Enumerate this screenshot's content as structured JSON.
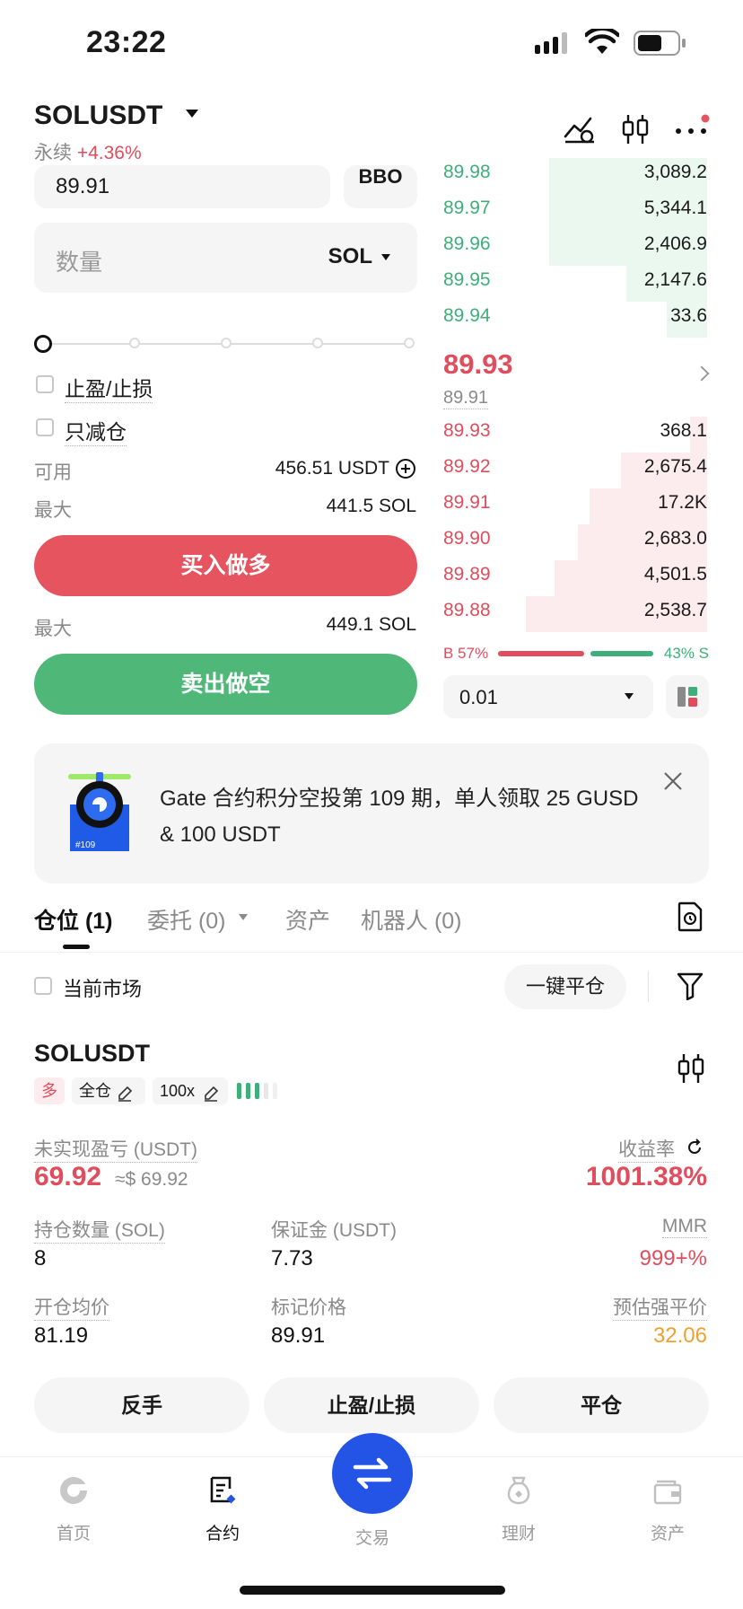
{
  "status_bar": {
    "time": "23:22"
  },
  "header": {
    "pair": "SOLUSDT",
    "contract_type": "永续",
    "change": "+4.36%"
  },
  "order_form": {
    "price_value": "89.91",
    "bbo_label": "BBO",
    "qty_placeholder": "数量",
    "qty_unit": "SOL",
    "tp_sl_label": "止盈/止损",
    "reduce_only_label": "只减仓",
    "available_label": "可用",
    "available_value": "456.51 USDT",
    "max_label": "最大",
    "max_buy_value": "441.5 SOL",
    "buy_label": "买入做多",
    "max_sell_value": "449.1 SOL",
    "sell_label": "卖出做空",
    "slider_percent": 0
  },
  "order_book": {
    "asks": [
      {
        "price": "89.98",
        "qty": "3,089.2",
        "depth": 0.55
      },
      {
        "price": "89.97",
        "qty": "5,344.1",
        "depth": 0.55
      },
      {
        "price": "89.96",
        "qty": "2,406.9",
        "depth": 0.55
      },
      {
        "price": "89.95",
        "qty": "2,147.6",
        "depth": 0.28
      },
      {
        "price": "89.94",
        "qty": "33.6",
        "depth": 0.14
      }
    ],
    "last_price": "89.93",
    "mark_price": "89.91",
    "bids": [
      {
        "price": "89.93",
        "qty": "368.1",
        "depth": 0.06
      },
      {
        "price": "89.92",
        "qty": "2,675.4",
        "depth": 0.3
      },
      {
        "price": "89.91",
        "qty": "17.2K",
        "depth": 0.41
      },
      {
        "price": "89.90",
        "qty": "2,683.0",
        "depth": 0.45
      },
      {
        "price": "89.89",
        "qty": "4,501.5",
        "depth": 0.53
      },
      {
        "price": "89.88",
        "qty": "2,538.7",
        "depth": 0.63
      }
    ],
    "buy_ratio": "B 57%",
    "sell_ratio": "43% S",
    "tick_size": "0.01"
  },
  "banner": {
    "text": "Gate 合约积分空投第 109 期，单人领取 25 GUSD & 100 USDT",
    "badge": "#109"
  },
  "tabs": [
    {
      "label": "仓位 (1)"
    },
    {
      "label": "委托 (0)"
    },
    {
      "label": "资产"
    },
    {
      "label": "机器人 (0)"
    }
  ],
  "filters": {
    "current_market_label": "当前市场",
    "close_all_label": "一键平仓"
  },
  "position": {
    "pair": "SOLUSDT",
    "side_tag": "多",
    "margin_mode": "全仓",
    "leverage": "100x",
    "upnl_label": "未实现盈亏 (USDT)",
    "upnl_value": "69.92",
    "upnl_usd": "≈$ 69.92",
    "roe_label": "收益率",
    "roe_value": "1001.38%",
    "size_label": "持仓数量 (SOL)",
    "size_value": "8",
    "margin_label": "保证金 (USDT)",
    "margin_value": "7.73",
    "mmr_label": "MMR",
    "mmr_value": "999+%",
    "entry_label": "开仓均价",
    "entry_value": "81.19",
    "mark_label": "标记价格",
    "mark_value": "89.91",
    "liq_label": "预估强平价",
    "liq_value": "32.06",
    "reverse_label": "反手",
    "tpsl_label": "止盈/止损",
    "close_label": "平仓"
  },
  "nav": {
    "home": "首页",
    "futures": "合约",
    "trade": "交易",
    "earn": "理财",
    "assets": "资产"
  },
  "colors": {
    "up": "#3fae7a",
    "down": "#e04d5c",
    "brand_blue": "#2354e6",
    "liq_orange": "#f0a030"
  }
}
